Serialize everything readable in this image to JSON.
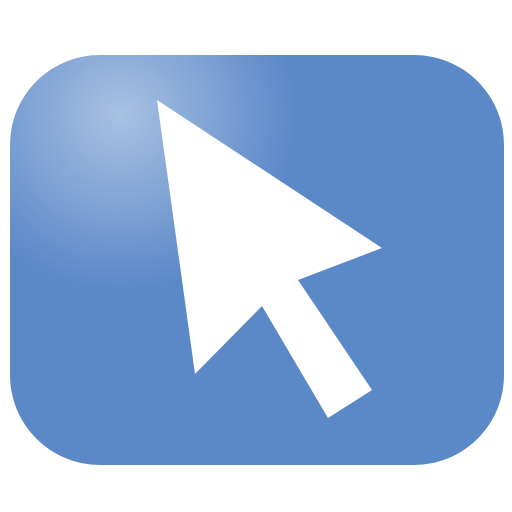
{
  "icon": {
    "name": "mouse-pointer-icon",
    "colors": {
      "background": "#5B88C7",
      "highlight": "#A8C1E3",
      "cursor": "#FFFFFF"
    }
  }
}
